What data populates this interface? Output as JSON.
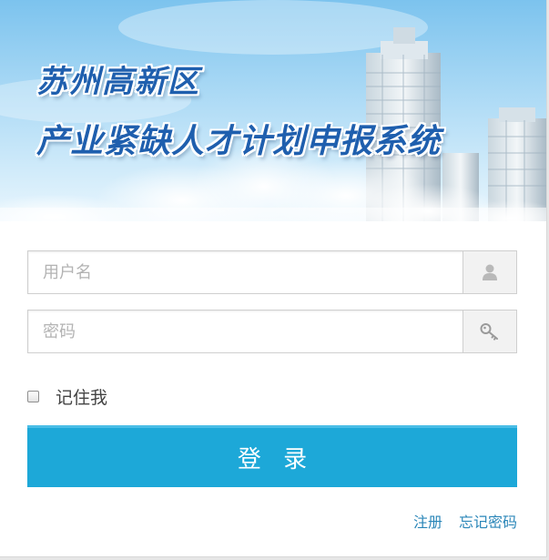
{
  "banner": {
    "line1": "苏州高新区",
    "line2": "产业紧缺人才计划申报系统"
  },
  "form": {
    "username_placeholder": "用户名",
    "username_icon": "user-icon",
    "password_placeholder": "密码",
    "password_icon": "key-icon",
    "remember_label": "记住我",
    "remember_checked": false,
    "login_label": "登 录"
  },
  "links": {
    "register": "注册",
    "forgot_password": "忘记密码"
  },
  "colors": {
    "accent": "#1da8d8",
    "link": "#2a86b8",
    "title": "#1f5fae"
  }
}
